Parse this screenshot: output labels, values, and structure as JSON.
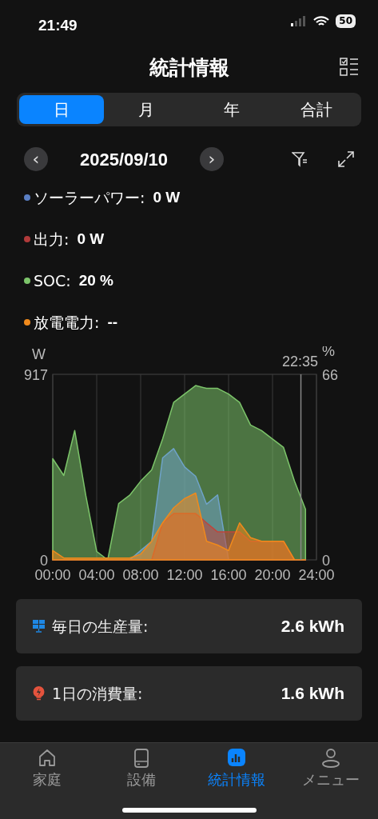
{
  "status_bar": {
    "time": "21:49",
    "battery": "50"
  },
  "header": {
    "title": "統計情報"
  },
  "segments": [
    {
      "label": "日",
      "selected": true
    },
    {
      "label": "月",
      "selected": false
    },
    {
      "label": "年",
      "selected": false
    },
    {
      "label": "合計",
      "selected": false
    }
  ],
  "date_nav": {
    "prev": "‹",
    "date": "2025/09/10",
    "next": "›"
  },
  "readings": [
    {
      "label": "ソーラーパワー:",
      "value": "0 W",
      "color": "#5a7fc4"
    },
    {
      "label": "出力:",
      "value": "0 W",
      "color": "#b03a3a"
    },
    {
      "label": "SOC:",
      "value": "20 %",
      "color": "#7cc46a"
    },
    {
      "label": "放電電力:",
      "value": "--",
      "color": "#f08a1c"
    }
  ],
  "chart_data": {
    "type": "area",
    "ylabel": "W",
    "y2label": "%",
    "x": [
      0,
      1,
      2,
      3,
      4,
      5,
      6,
      7,
      8,
      9,
      10,
      11,
      12,
      13,
      14,
      15,
      16,
      17,
      18,
      19,
      20,
      21,
      22,
      23
    ],
    "xlim": [
      0,
      24
    ],
    "stacked": false,
    "grid": true,
    "xticks": [
      {
        "value": 0,
        "label": "00:00"
      },
      {
        "value": 4,
        "label": "04:00"
      },
      {
        "value": 8,
        "label": "08:00"
      },
      {
        "value": 12,
        "label": "12:00"
      },
      {
        "value": 16,
        "label": "16:00"
      },
      {
        "value": 20,
        "label": "20:00"
      },
      {
        "value": 24,
        "label": "24:00"
      }
    ],
    "ylim": [
      0,
      917
    ],
    "yticks": [
      0,
      917
    ],
    "y2lim": [
      0,
      66
    ],
    "y2ticks": [
      0,
      66
    ],
    "series": [
      {
        "color": "#7cc46a",
        "axis": "y2",
        "values": [
          36,
          30,
          46,
          23,
          3,
          0,
          20,
          23,
          28,
          32,
          43,
          56,
          59,
          62,
          61,
          61,
          59,
          56,
          48,
          46,
          43,
          40,
          28,
          18
        ]
      },
      {
        "color": "#6fa3c9",
        "values": [
          0,
          0,
          0,
          0,
          0,
          0,
          0,
          0,
          46,
          92,
          504,
          550,
          459,
          413,
          275,
          321,
          0,
          0,
          0,
          0,
          0,
          0,
          0,
          0
        ]
      },
      {
        "color": "#c0443a",
        "values": [
          0,
          0,
          0,
          0,
          0,
          0,
          0,
          0,
          0,
          0,
          183,
          229,
          229,
          229,
          183,
          138,
          138,
          138,
          92,
          92,
          92,
          92,
          0,
          0
        ]
      },
      {
        "color": "#f08a1c",
        "values": [
          46,
          9,
          9,
          9,
          9,
          9,
          9,
          9,
          28,
          92,
          183,
          257,
          303,
          330,
          92,
          73,
          46,
          183,
          110,
          92,
          92,
          92,
          0,
          0
        ]
      }
    ],
    "ref_lines": [
      {
        "axis": "x",
        "value": 22.583
      }
    ],
    "annotations": [
      "22:35"
    ]
  },
  "summary": [
    {
      "kind": "solar",
      "label": "毎日の生産量:",
      "value": "2.6 kWh"
    },
    {
      "kind": "bulb",
      "label": "1日の消費量:",
      "value": "1.6 kWh"
    }
  ],
  "tab_bar": [
    {
      "kind": "home",
      "label": "家庭",
      "selected": false
    },
    {
      "kind": "device",
      "label": "設備",
      "selected": false
    },
    {
      "kind": "stats",
      "label": "統計情報",
      "selected": true
    },
    {
      "kind": "person",
      "label": "メニュー",
      "selected": false
    }
  ]
}
